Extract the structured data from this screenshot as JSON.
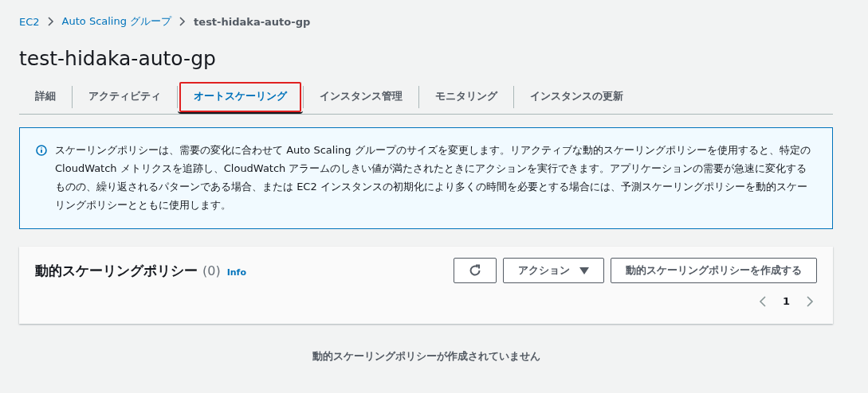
{
  "breadcrumb": [
    {
      "label": "EC2",
      "link": true
    },
    {
      "label": "Auto Scaling グループ",
      "link": true
    },
    {
      "label": "test-hidaka-auto-gp",
      "link": false
    }
  ],
  "title": "test-hidaka-auto-gp",
  "tabs": [
    {
      "label": "詳細",
      "selected": false,
      "highlighted": false
    },
    {
      "label": "アクティビティ",
      "selected": false,
      "highlighted": false
    },
    {
      "label": "オートスケーリング",
      "selected": true,
      "highlighted": true
    },
    {
      "label": "インスタンス管理",
      "selected": false,
      "highlighted": false
    },
    {
      "label": "モニタリング",
      "selected": false,
      "highlighted": false
    },
    {
      "label": "インスタンスの更新",
      "selected": false,
      "highlighted": false
    }
  ],
  "info_alert": {
    "text": "スケーリングポリシーは、需要の変化に合わせて Auto Scaling グループのサイズを変更します。リアクティブな動的スケーリングポリシーを使用すると、特定の CloudWatch メトリクスを追跡し、CloudWatch アラームのしきい値が満たされたときにアクションを実行できます。アプリケーションの需要が急速に変化するものの、繰り返されるパターンである場合、または EC2 インスタンスの初期化により多くの時間を必要とする場合には、予測スケーリングポリシーを動的スケーリングポリシーとともに使用します。"
  },
  "policy_panel": {
    "title": "動的スケーリングポリシー",
    "count": "(0)",
    "info_link": "Info",
    "actions_button": "アクション",
    "create_button": "動的スケーリングポリシーを作成する",
    "pagination": {
      "page": "1"
    }
  },
  "empty_state": {
    "title": "動的スケーリングポリシーが作成されていません"
  }
}
